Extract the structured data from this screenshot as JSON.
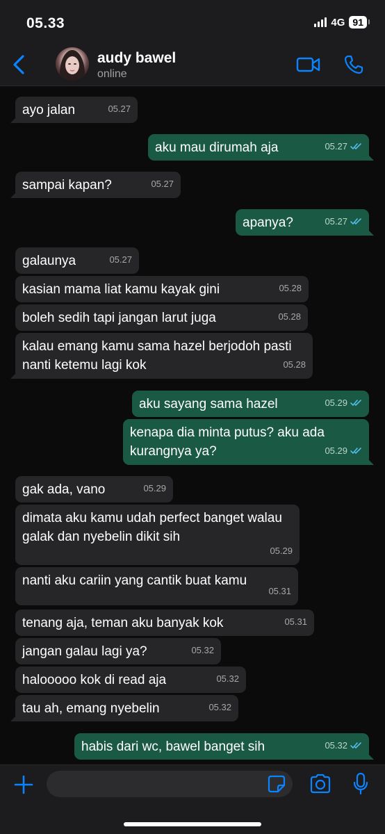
{
  "status": {
    "time": "05.33",
    "network": "4G",
    "battery": "91"
  },
  "header": {
    "contact_name": "audy bawel",
    "contact_status": "online"
  },
  "colors": {
    "accent": "#0a84ff",
    "incoming_bubble": "#262628",
    "outgoing_bubble": "#1a5944",
    "read_tick": "#53bdeb"
  },
  "messages": [
    {
      "dir": "in",
      "text": "ayo jalan",
      "time": "05.27"
    },
    {
      "dir": "out",
      "text": "aku mau dirumah aja",
      "time": "05.27",
      "status": "read"
    },
    {
      "dir": "in",
      "text": "sampai kapan?",
      "time": "05.27"
    },
    {
      "dir": "out",
      "text": "apanya?",
      "time": "05.27",
      "status": "read"
    },
    {
      "dir": "in",
      "text": "galaunya",
      "time": "05.27"
    },
    {
      "dir": "in",
      "text": "kasian mama liat kamu kayak gini",
      "time": "05.28"
    },
    {
      "dir": "in",
      "text": "boleh sedih tapi jangan larut juga",
      "time": "05.28"
    },
    {
      "dir": "in",
      "text": "kalau emang kamu sama hazel berjodoh pasti nanti ketemu lagi kok",
      "time": "05.28"
    },
    {
      "dir": "out",
      "text": "aku sayang sama hazel",
      "time": "05.29",
      "status": "read"
    },
    {
      "dir": "out",
      "text": "kenapa dia minta putus? aku ada kurangnya ya?",
      "time": "05.29",
      "status": "read"
    },
    {
      "dir": "in",
      "text": "gak ada, vano",
      "time": "05.29"
    },
    {
      "dir": "in",
      "text": "dimata aku kamu udah perfect banget walau galak dan nyebelin dikit sih",
      "time": "05.29"
    },
    {
      "dir": "in",
      "text": "nanti aku cariin yang cantik buat kamu",
      "time": "05.31"
    },
    {
      "dir": "in",
      "text": "tenang aja, teman aku banyak kok",
      "time": "05.31"
    },
    {
      "dir": "in",
      "text": "jangan galau lagi ya?",
      "time": "05.32"
    },
    {
      "dir": "in",
      "text": "halooooo kok di read aja",
      "time": "05.32"
    },
    {
      "dir": "in",
      "text": "tau ah, emang nyebelin",
      "time": "05.32"
    },
    {
      "dir": "out",
      "text": "habis dari wc, bawel banget sih",
      "time": "05.32",
      "status": "read"
    }
  ],
  "icons": {
    "back": "chevron-left-icon",
    "video": "video-camera-icon",
    "call": "phone-icon",
    "plus": "plus-icon",
    "sticker": "sticker-icon",
    "camera": "camera-icon",
    "mic": "microphone-icon"
  }
}
